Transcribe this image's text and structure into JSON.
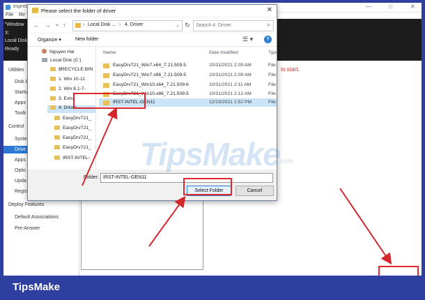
{
  "background_app": {
    "title": "espreb",
    "menu": [
      "File",
      "Re"
    ],
    "console_lines": [
      "\"Window",
      "X:",
      "Local Disk",
      "Ready"
    ],
    "sidebar": [
      {
        "label": "Utilities",
        "kind": "head"
      },
      {
        "label": "Disk C",
        "kind": "sub"
      },
      {
        "label": "Startu",
        "kind": "sub"
      },
      {
        "label": "Appx",
        "kind": "sub"
      },
      {
        "label": "Toolk",
        "kind": "sub"
      },
      {
        "label": "Control",
        "kind": "head"
      },
      {
        "label": "Syste",
        "kind": "sub"
      },
      {
        "label": "Drive",
        "kind": "active"
      },
      {
        "label": "Apps",
        "kind": "sub"
      },
      {
        "label": "Optic",
        "kind": "sub"
      },
      {
        "label": "Upda",
        "kind": "sub"
      },
      {
        "label": "Regis",
        "kind": "sub"
      },
      {
        "label": "Deploy Features",
        "kind": "head"
      },
      {
        "label": "Default Associations",
        "kind": "sub"
      },
      {
        "label": "Pre-Answer",
        "kind": "sub"
      }
    ],
    "hint_text": "to start.",
    "window_controls": [
      "—",
      "□",
      "✕"
    ]
  },
  "dialog": {
    "title": "Please select the folder of driver",
    "close": "✕",
    "nav": {
      "back": "←",
      "forward": "→",
      "up_menu": "⌄",
      "up": "↑"
    },
    "breadcrumb": [
      "Local Disk ...",
      "4. Driver"
    ],
    "search_placeholder": "Search 4. Driver",
    "toolbar": {
      "organize": "Organize ▾",
      "new_folder": "New folder"
    },
    "tree": [
      {
        "label": "Nguyen Hai",
        "icon": "user"
      },
      {
        "label": "Local Disk (C:)",
        "icon": "drive"
      },
      {
        "label": "$RECYCLE.BIN",
        "icon": "folder"
      },
      {
        "label": "1. Win 10-11",
        "icon": "folder"
      },
      {
        "label": "2. Win 8.1-7-",
        "icon": "folder"
      },
      {
        "label": "3. Extra",
        "icon": "folder"
      },
      {
        "label": "4. Driver",
        "icon": "folder",
        "selected": true
      },
      {
        "label": "EasyDrv721_",
        "icon": "folder"
      },
      {
        "label": "EasyDrv721_",
        "icon": "folder"
      },
      {
        "label": "EasyDrv721_",
        "icon": "folder"
      },
      {
        "label": "EasyDrv721_",
        "icon": "folder"
      },
      {
        "label": "IRST-INTEL-",
        "icon": "folder"
      }
    ],
    "columns": {
      "name": "Name",
      "date": "Date modified",
      "type": "Type"
    },
    "files": [
      {
        "name": "EasyDrv721_Win7.x64_7.21.509.5",
        "date": "10/31/2021 2:09 AM",
        "type": "File fo"
      },
      {
        "name": "EasyDrv721_Win7.x86_7.21.509.5",
        "date": "10/31/2021 2:09 AM",
        "type": "File fo"
      },
      {
        "name": "EasyDrv721_Win10.x64_7.21.509.6",
        "date": "10/31/2021 2:11 AM",
        "type": "File fo"
      },
      {
        "name": "EasyDrv721_Win10.x86_7.21.509.5",
        "date": "10/31/2021 2:12 AM",
        "type": "File fo"
      },
      {
        "name": "IRST-INTEL-GEN11",
        "date": "12/19/2021 1:52 PM",
        "type": "File fo",
        "selected": true
      }
    ],
    "folder_label": "Folder:",
    "folder_value": "IRST-INTEL-GEN11",
    "select_button": "Select Folder",
    "cancel_button": "Cancel"
  },
  "watermark": {
    "text": "TipsMake",
    "suffix": ".com"
  },
  "brand_footer": "TipsMake",
  "colors": {
    "frame_bg": "#2e3fa0",
    "highlight": "#e0262f",
    "accent": "#2d7ad6"
  }
}
